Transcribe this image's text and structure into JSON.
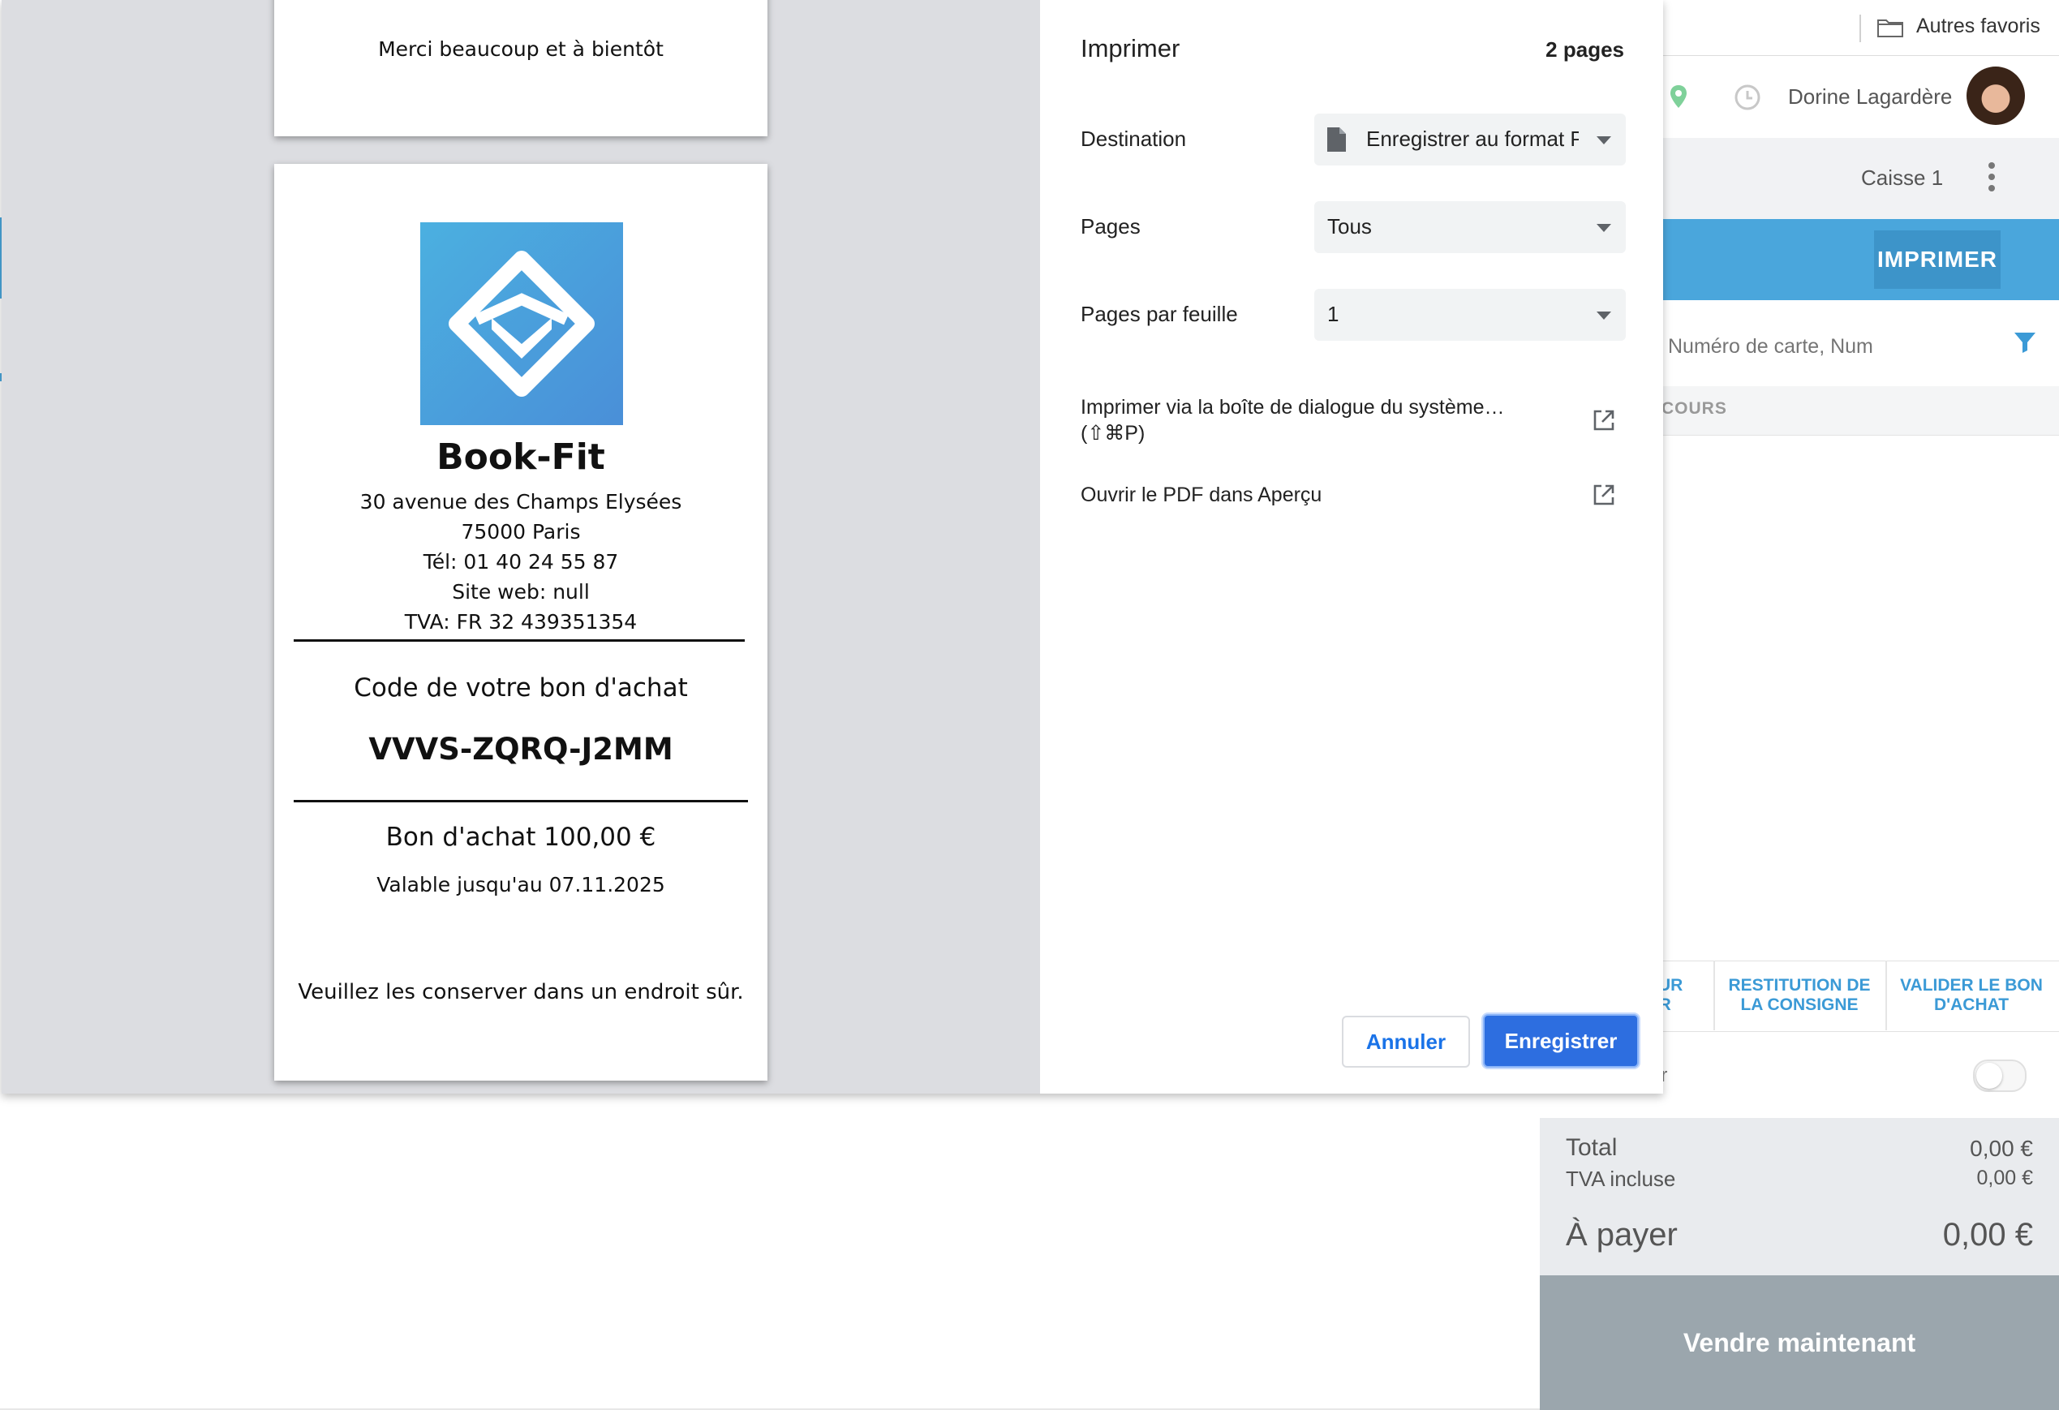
{
  "browser": {
    "bookmarks_other": "Autres favoris"
  },
  "pos": {
    "user_name": "Dorine Lagardère",
    "register": "Caisse 1",
    "print_button": "IMPRIMER",
    "search_placeholder": "Numéro de carte, Num",
    "section_label": "COURS",
    "actions": {
      "partial_label": "SUR\nR",
      "deposit_return": "RESTITUTION DE LA CONSIGNE",
      "validate_voucher": "VALIDER LE BON D'ACHAT"
    },
    "toggle_label_fragment": "er",
    "totals": {
      "total_label": "Total",
      "total_value": "0,00 €",
      "vat_label": "TVA incluse",
      "vat_value": "0,00 €",
      "pay_label": "À payer",
      "pay_value": "0,00 €"
    },
    "sell_button": "Vendre maintenant",
    "accent_color": "#4aa6dc"
  },
  "print_dialog": {
    "title": "Imprimer",
    "page_count": "2 pages",
    "destination_label": "Destination",
    "destination_value": "Enregistrer au format PDF",
    "pages_label": "Pages",
    "pages_value": "Tous",
    "pages_per_sheet_label": "Pages par feuille",
    "pages_per_sheet_value": "1",
    "system_dialog_link": "Imprimer via la boîte de dialogue du système…",
    "system_dialog_shortcut": "(⇧⌘P)",
    "open_pdf_link": "Ouvrir le PDF dans Aperçu",
    "cancel_button": "Annuler",
    "save_button": "Enregistrer",
    "primary_color": "#2d6ee0"
  },
  "receipt": {
    "page1_footer": "Merci beaucoup et à bientôt",
    "store_name": "Book-Fit",
    "address_line1": "30 avenue des Champs Elysées",
    "address_line2": "75000 Paris",
    "phone": "Tél: 01 40 24 55 87",
    "website": "Site web: null",
    "vat": "TVA: FR 32 439351354",
    "voucher_code_title": "Code de votre bon d'achat",
    "voucher_code": "VVVS-ZQRQ-J2MM",
    "voucher_amount": "Bon d'achat 100,00 €",
    "valid_until": "Valable jusqu'au 07.11.2025",
    "keep_safe": "Veuillez les conserver dans un endroit sûr.",
    "logo_color": "#4a9ad8"
  }
}
